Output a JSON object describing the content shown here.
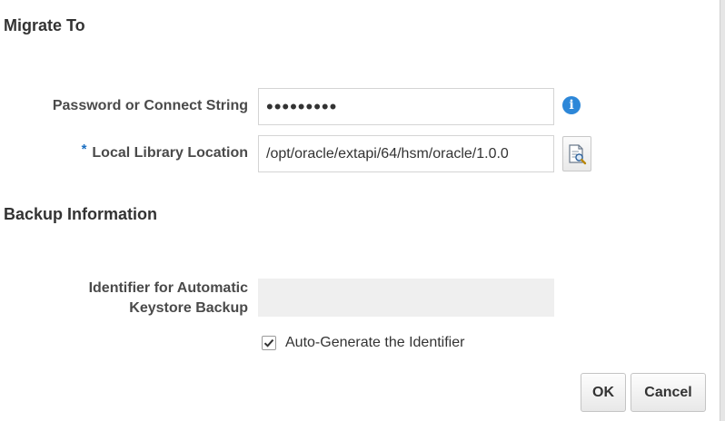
{
  "sections": {
    "migrate_title": "Migrate To",
    "backup_title": "Backup Information"
  },
  "fields": {
    "password_label": "Password or Connect String",
    "password_value": "•••••••••",
    "library_required_mark": "*",
    "library_label": "Local Library Location",
    "library_value": "/opt/oracle/extapi/64/hsm/oracle/1.0.0",
    "identifier_label_line1": "Identifier for Automatic",
    "identifier_label_line2": "Keystore Backup",
    "identifier_value": ""
  },
  "checkbox": {
    "label": "Auto-Generate the Identifier",
    "checked": true
  },
  "icons": {
    "info": "info-icon",
    "browse": "search-document-icon",
    "check": "checkmark-icon",
    "info_glyph": "i"
  },
  "buttons": {
    "ok_label": "OK",
    "cancel_label": "Cancel"
  },
  "colors": {
    "required_star": "#1a6fc2",
    "info_icon": "#2d87d8"
  }
}
